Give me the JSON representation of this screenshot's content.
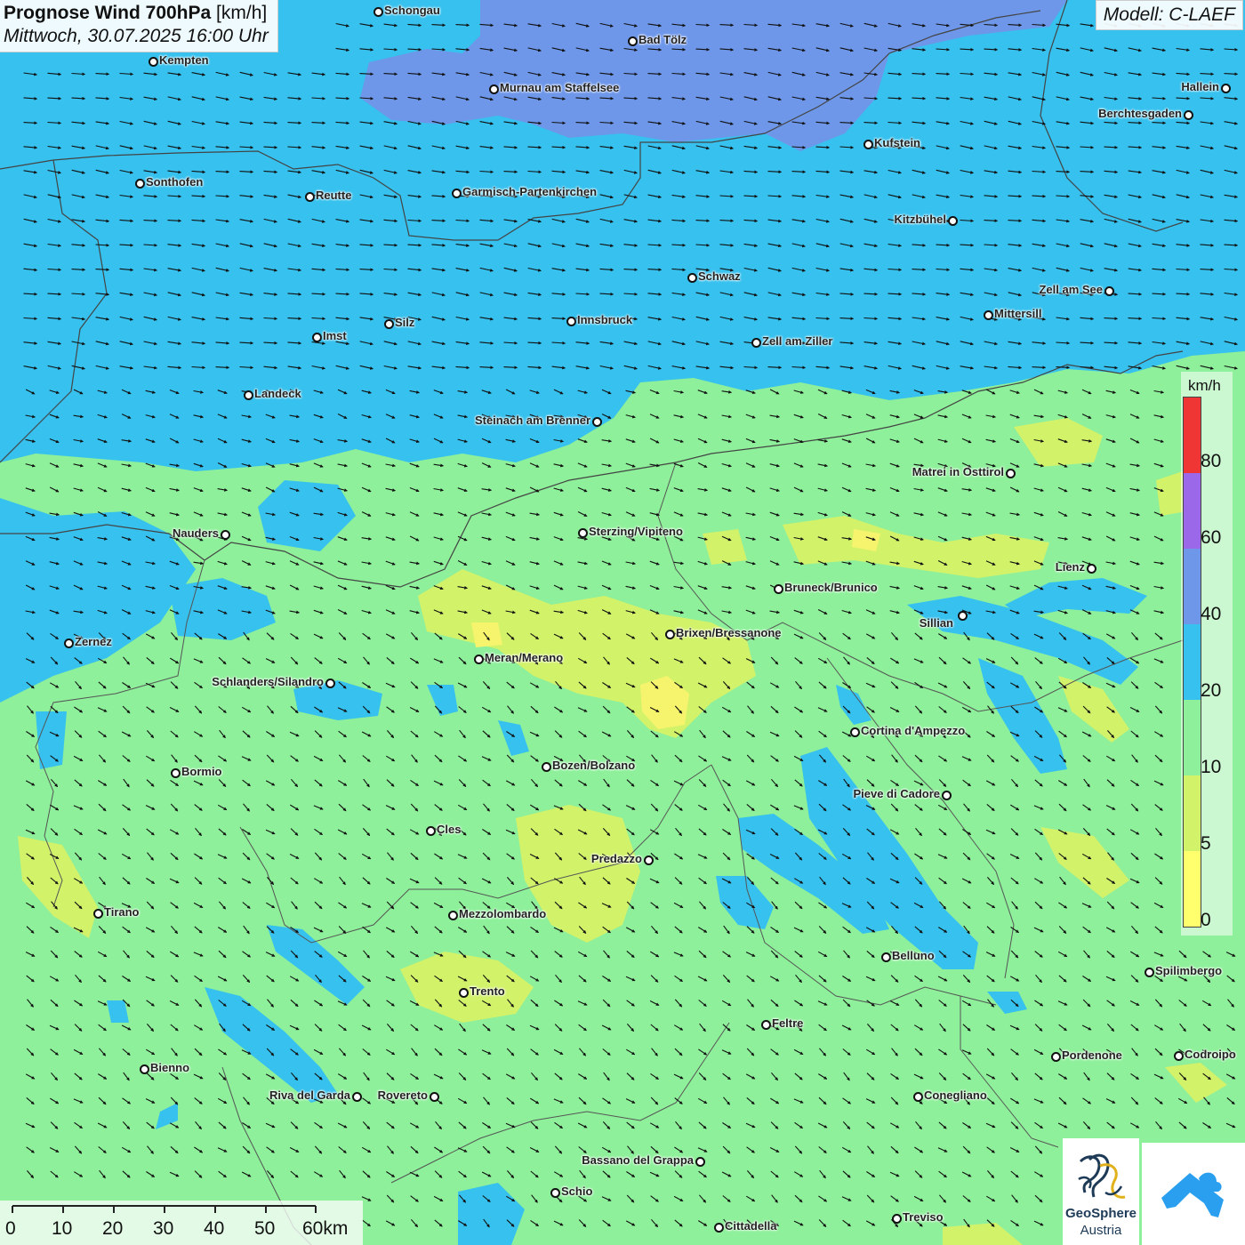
{
  "header": {
    "title": "Prognose Wind 700hPa",
    "title_unit": "[km/h]",
    "subtitle": "Mittwoch, 30.07.2025 16:00 Uhr",
    "model": "Modell: C-LAEF"
  },
  "legend": {
    "unit": "km/h",
    "labels": [
      "80",
      "60",
      "40",
      "20",
      "10",
      "5",
      "0"
    ],
    "colors_top_to_bottom": [
      "#f03535",
      "#9a68e8",
      "#6e97ea",
      "#36c1ee",
      "#8ef09a",
      "#d2f26a",
      "#ffff6e"
    ]
  },
  "scale_bar": {
    "labels": [
      "0",
      "10",
      "20",
      "30",
      "40",
      "50",
      "60km"
    ]
  },
  "logos": {
    "geosphere": [
      "GeoSphere",
      "Austria"
    ],
    "geosphere_icon": "geosphere-logo-icon",
    "app_icon": "wind-app-icon"
  },
  "wind": {
    "direction": "toward east-southeast",
    "speed_classes_shown": [
      "0-5",
      "5-10",
      "10-20",
      "20-40",
      "40-60"
    ]
  },
  "cities": [
    {
      "name": "Schongau"
    },
    {
      "name": "Bad Tölz"
    },
    {
      "name": "Kempten"
    },
    {
      "name": "Murnau am Staffelsee"
    },
    {
      "name": "Hallein"
    },
    {
      "name": "Berchtesgaden"
    },
    {
      "name": "Kufstein"
    },
    {
      "name": "Sonthofen"
    },
    {
      "name": "Reutte"
    },
    {
      "name": "Garmisch-Partenkirchen"
    },
    {
      "name": "Kitzbühel"
    },
    {
      "name": "Schwaz"
    },
    {
      "name": "Zell am See"
    },
    {
      "name": "Mittersill"
    },
    {
      "name": "Innsbruck"
    },
    {
      "name": "Silz"
    },
    {
      "name": "Imst"
    },
    {
      "name": "Zell am Ziller"
    },
    {
      "name": "Landeck"
    },
    {
      "name": "Steinach am Brenner"
    },
    {
      "name": "Matrei in Osttirol"
    },
    {
      "name": "Nauders"
    },
    {
      "name": "Sterzing/Vipiteno"
    },
    {
      "name": "Lienz"
    },
    {
      "name": "Bruneck/Brunico"
    },
    {
      "name": "Sillian"
    },
    {
      "name": "Brixen/Bressanone"
    },
    {
      "name": "Zernez"
    },
    {
      "name": "Meran/Merano"
    },
    {
      "name": "Schlanders/Silandro"
    },
    {
      "name": "Cortina d'Ampezzo"
    },
    {
      "name": "Bormio"
    },
    {
      "name": "Bozen/Bolzano"
    },
    {
      "name": "Pieve di Cadore"
    },
    {
      "name": "Cles"
    },
    {
      "name": "Predazzo"
    },
    {
      "name": "Tirano"
    },
    {
      "name": "Mezzolombardo"
    },
    {
      "name": "Belluno"
    },
    {
      "name": "Spilimbergo"
    },
    {
      "name": "Trento"
    },
    {
      "name": "Feltre"
    },
    {
      "name": "Bienno"
    },
    {
      "name": "Pordenone"
    },
    {
      "name": "Codroipo"
    },
    {
      "name": "Riva del Garda"
    },
    {
      "name": "Rovereto"
    },
    {
      "name": "Conegliano"
    },
    {
      "name": "Bassano del Grappa"
    },
    {
      "name": "Schio"
    },
    {
      "name": "Treviso"
    },
    {
      "name": "Cittadella"
    }
  ]
}
